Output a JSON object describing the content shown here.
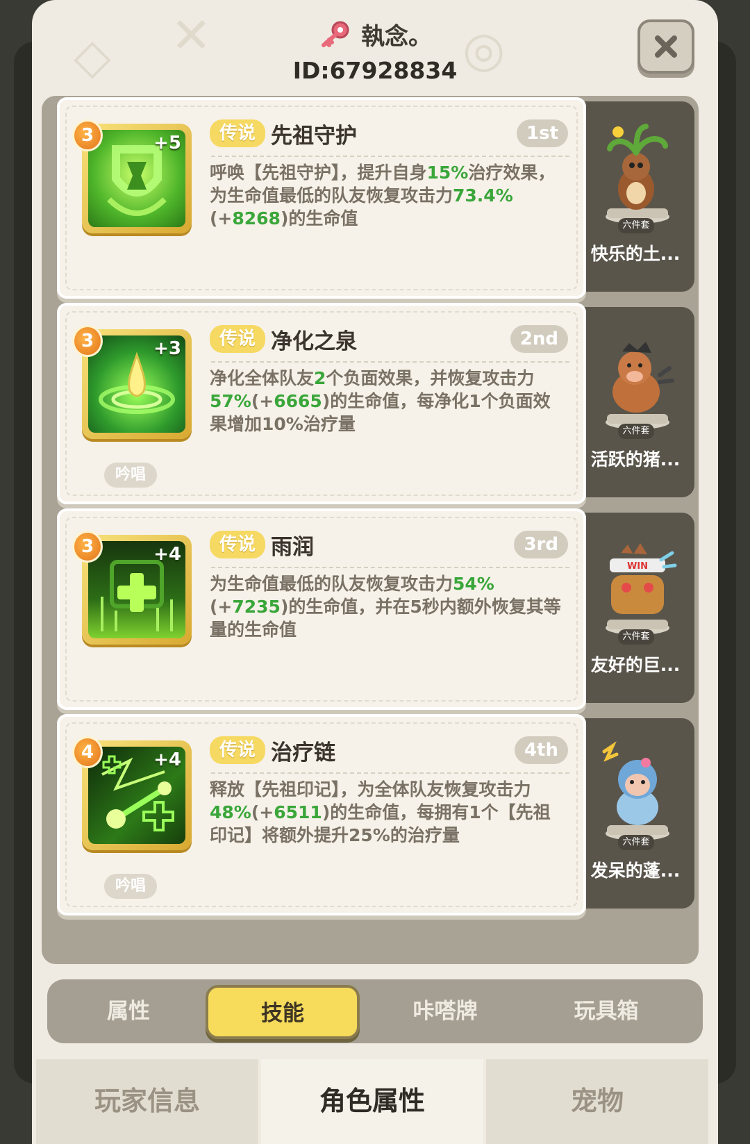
{
  "header": {
    "player_name": "執念。",
    "player_id": "ID:67928834",
    "close_icon": "close-icon"
  },
  "skills": [
    {
      "level": "3",
      "plus": "+5",
      "rarity": "传说",
      "title": "先祖守护",
      "rank": "1st",
      "desc_parts": [
        "呼唤【先祖守护】，提升自身",
        "15%",
        "治疗效果，为生命值最低的队友恢复攻击力",
        "73.4%",
        "(+",
        "8268",
        ")的生命值"
      ],
      "cast_tag": "",
      "icon": "ancestor-shield-icon",
      "pet_name": "快乐的土...",
      "pet_set": "六件套"
    },
    {
      "level": "3",
      "plus": "+3",
      "rarity": "传说",
      "title": "净化之泉",
      "rank": "2nd",
      "desc_parts": [
        "净化全体队友",
        "2",
        "个负面效果，并恢复攻击力",
        "57%",
        "(+",
        "6665",
        ")的生命值，每净化1个负面效果增加10%治疗量"
      ],
      "cast_tag": "吟唱",
      "icon": "spring-drop-icon",
      "pet_name": "活跃的猪...",
      "pet_set": "六件套"
    },
    {
      "level": "3",
      "plus": "+4",
      "rarity": "传说",
      "title": "雨润",
      "rank": "3rd",
      "desc_parts": [
        "为生命值最低的队友恢复攻击力",
        "54%",
        "(+",
        "7235",
        ")的生命值，并在5秒内额外恢复其等量的生命值"
      ],
      "cast_tag": "",
      "icon": "heal-cross-icon",
      "pet_name": "友好的巨...",
      "pet_set": "六件套"
    },
    {
      "level": "4",
      "plus": "+4",
      "rarity": "传说",
      "title": "治疗链",
      "rank": "4th",
      "desc_parts": [
        "释放【先祖印记】，为全体队友恢复攻击力",
        "48%",
        "(+",
        "6511",
        ")的生命值，每拥有1个【先祖印记】将额外提升25%的治疗量"
      ],
      "cast_tag": "吟唱",
      "icon": "heal-chain-icon",
      "pet_name": "发呆的蓬...",
      "pet_set": "六件套"
    }
  ],
  "subtabs": [
    "属性",
    "技能",
    "咔嗒牌",
    "玩具箱"
  ],
  "active_subtab": "技能",
  "bottom_tabs": [
    "玩家信息",
    "角色属性",
    "宠物"
  ],
  "active_bottom_tab": "角色属性",
  "colors": {
    "accent_yellow": "#f7dc5c",
    "green_value": "#3aa63a",
    "panel_bg": "#efebe2"
  }
}
